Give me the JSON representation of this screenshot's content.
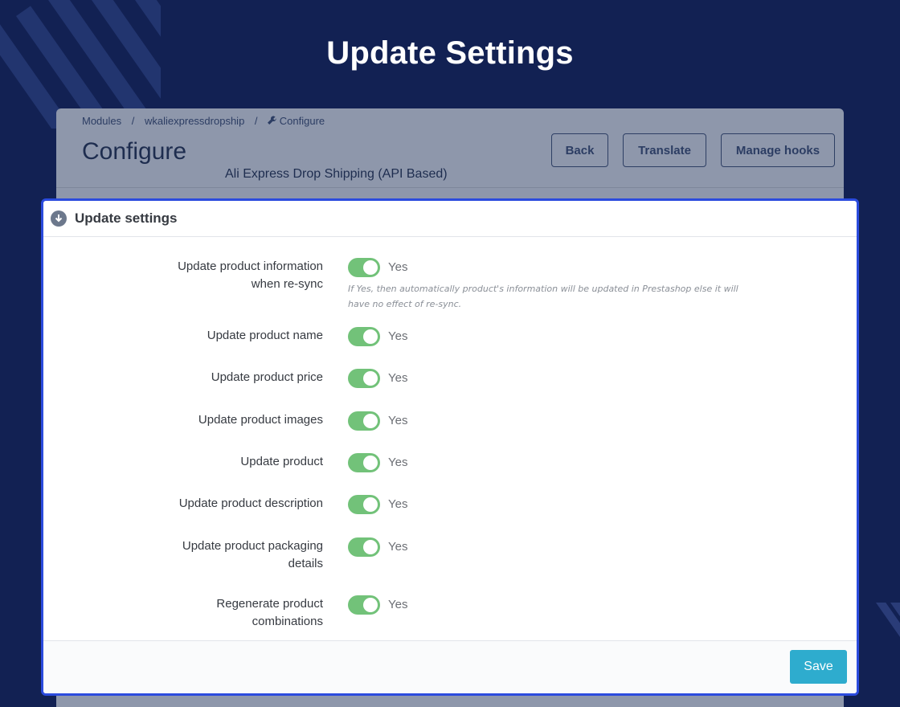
{
  "page_title": "Update Settings",
  "breadcrumb": {
    "items": [
      "Modules",
      "wkaliexpressdropship",
      "Configure"
    ],
    "separator": "/"
  },
  "header": {
    "title": "Configure",
    "subtitle": "Ali Express Drop Shipping (API Based)",
    "buttons": {
      "back": "Back",
      "translate": "Translate",
      "manage_hooks": "Manage hooks"
    }
  },
  "panel": {
    "heading": "Update settings",
    "heading_icon": "arrow-circle-down-icon",
    "fields": [
      {
        "label_lines": [
          "Update product information",
          "when re-sync"
        ],
        "value": "Yes",
        "enabled": true,
        "help_lines": [
          "If Yes, then automatically product's information will be updated in Prestashop else it will",
          "have no effect of re-sync."
        ]
      },
      {
        "label_lines": [
          "Update product name"
        ],
        "value": "Yes",
        "enabled": true
      },
      {
        "label_lines": [
          "Update product price"
        ],
        "value": "Yes",
        "enabled": true
      },
      {
        "label_lines": [
          "Update product images"
        ],
        "value": "Yes",
        "enabled": true
      },
      {
        "label_lines": [
          "Update product"
        ],
        "value": "Yes",
        "enabled": true
      },
      {
        "label_lines": [
          "Update product description"
        ],
        "value": "Yes",
        "enabled": true
      },
      {
        "label_lines": [
          "Update product packaging",
          "details"
        ],
        "value": "Yes",
        "enabled": true
      },
      {
        "label_lines": [
          "Regenerate product",
          "combinations"
        ],
        "value": "Yes",
        "enabled": true
      }
    ],
    "save_label": "Save"
  },
  "colors": {
    "background": "#122153",
    "panel_border": "#2b4bde",
    "switch_on": "#72c279",
    "save_button": "#2eacce"
  }
}
